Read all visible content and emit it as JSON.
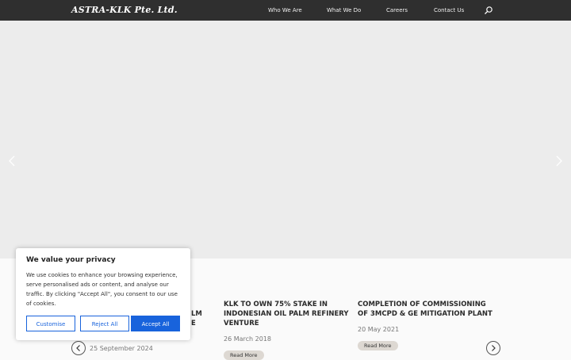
{
  "header": {
    "logo": "ASTRA-KLK Pte. Ltd.",
    "nav": [
      "Who We Are",
      "What We Do",
      "Careers",
      "Contact Us"
    ]
  },
  "news": {
    "items": [
      {
        "title_line1": "LM",
        "title_line2": "E",
        "date": "25 September 2024"
      },
      {
        "title": "KLK TO OWN 75% STAKE IN INDONESIAN OIL PALM REFINERY VENTURE",
        "date": "26 March 2018",
        "read_more": "Read More"
      },
      {
        "title": "COMPLETION OF COMMISSIONING OF 3MCPD & GE MITIGATION PLANT",
        "date": "20 May 2021",
        "read_more": "Read More"
      }
    ]
  },
  "cookie": {
    "title": "We value your privacy",
    "text": "We use cookies to enhance your browsing experience, serve personalised ads or content, and analyse our traffic. By clicking \"Accept All\", you consent to our use of cookies.",
    "customise": "Customise",
    "reject": "Reject All",
    "accept": "Accept All"
  },
  "colors": {
    "topbar": "#2f2f2f",
    "accent": "#1863dc",
    "hero": "#ececec"
  }
}
